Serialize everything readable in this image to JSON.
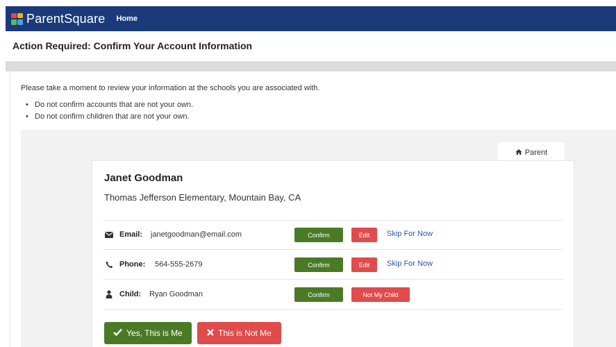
{
  "app": {
    "brand": "ParentSquare",
    "nav_home": "Home",
    "logo_colors": [
      "#e8473c",
      "#f4b400",
      "#5cb85c",
      "#4aa3df"
    ]
  },
  "page": {
    "title": "Action Required: Confirm Your Account Information",
    "intro": "Please take a moment to review your information at the schools you are associated with.",
    "bullets": [
      "Do not confirm accounts that are not your own.",
      "Do not confirm children that are not your own."
    ]
  },
  "tab": {
    "label": "Parent",
    "icon": "home-icon"
  },
  "person": {
    "name": "Janet Goodman",
    "school": "Thomas Jefferson Elementary, Mountain Bay, CA"
  },
  "rows": {
    "email": {
      "icon": "envelope-icon",
      "label": "Email:",
      "value": "janetgoodman@email.com",
      "confirm": "Confirm",
      "edit": "Edit",
      "skip": "Skip For Now"
    },
    "phone": {
      "icon": "phone-icon",
      "label": "Phone:",
      "value": "564-555-2679",
      "confirm": "Confirm",
      "edit": "Edit",
      "skip": "Skip For Now"
    },
    "child": {
      "icon": "user-icon",
      "label": "Child:",
      "value": "Ryan Goodman",
      "confirm": "Confirm",
      "not_my_child": "Not My Child"
    }
  },
  "actions": {
    "yes": "Yes, This is Me",
    "no": "This is Not Me"
  },
  "colors": {
    "topbar": "#1b3a7a",
    "confirm_green": "#4b7a27",
    "danger_red": "#e04b4b",
    "link_blue": "#2a55a6"
  }
}
